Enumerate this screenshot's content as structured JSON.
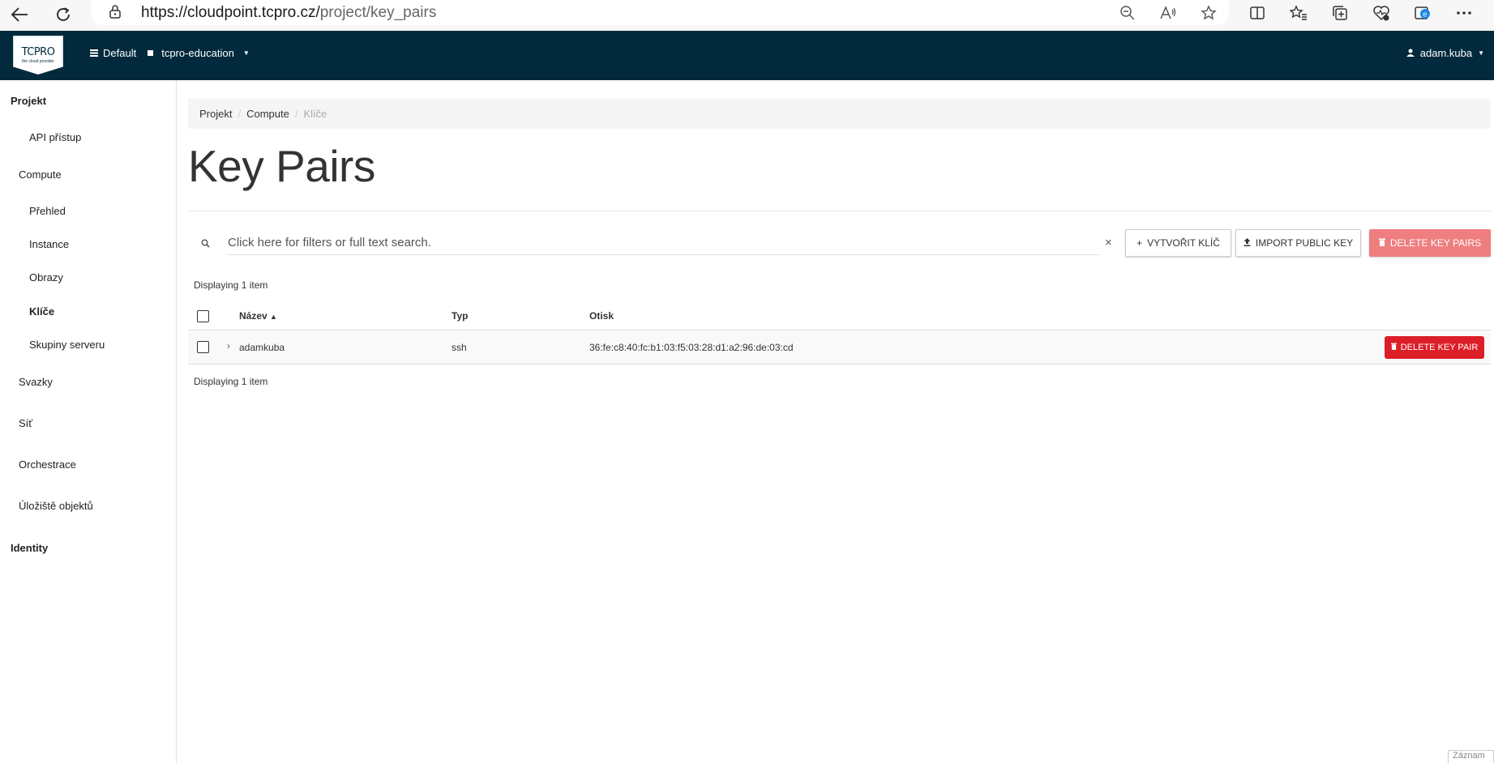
{
  "browser": {
    "url_host": "https://cloudpoint.tcpro.cz/",
    "url_path": "project/key_pairs"
  },
  "header": {
    "logo_brand": "TCPRO",
    "logo_tagline": "the cloud provider",
    "domain": "Default",
    "project": "tcpro-education",
    "user": "adam.kuba"
  },
  "sidebar": {
    "projekt": "Projekt",
    "api_access": "API přístup",
    "compute": "Compute",
    "prehled": "Přehled",
    "instance": "Instance",
    "obrazy": "Obrazy",
    "klice": "Klíče",
    "skupiny": "Skupiny serveru",
    "svazky": "Svazky",
    "sit": "Síť",
    "orchestrace": "Orchestrace",
    "uloziste": "Úložiště objektů",
    "identity": "Identity"
  },
  "breadcrumb": {
    "items": [
      "Projekt",
      "Compute",
      "Klíče"
    ]
  },
  "page": {
    "title": "Key Pairs"
  },
  "toolbar": {
    "search_placeholder": "Click here for filters or full text search.",
    "create_label": "VYTVOŘIT KLÍČ",
    "import_label": "IMPORT PUBLIC KEY",
    "delete_all_label": "DELETE KEY PAIRS"
  },
  "table": {
    "count_top": "Displaying 1 item",
    "count_bottom": "Displaying 1 item",
    "columns": {
      "name": "Název",
      "type": "Typ",
      "fingerprint": "Otisk"
    },
    "rows": [
      {
        "name": "adamkuba",
        "type": "ssh",
        "fingerprint": "36:fe:c8:40:fc:b1:03:f5:03:28:d1:a2:96:de:03:cd",
        "action": "DELETE KEY PAIR"
      }
    ]
  },
  "corner_tab": "Záznam",
  "colors": {
    "header_bg": "#022a3c",
    "danger": "#dc1e28",
    "danger_disabled": "#ef7e80"
  }
}
